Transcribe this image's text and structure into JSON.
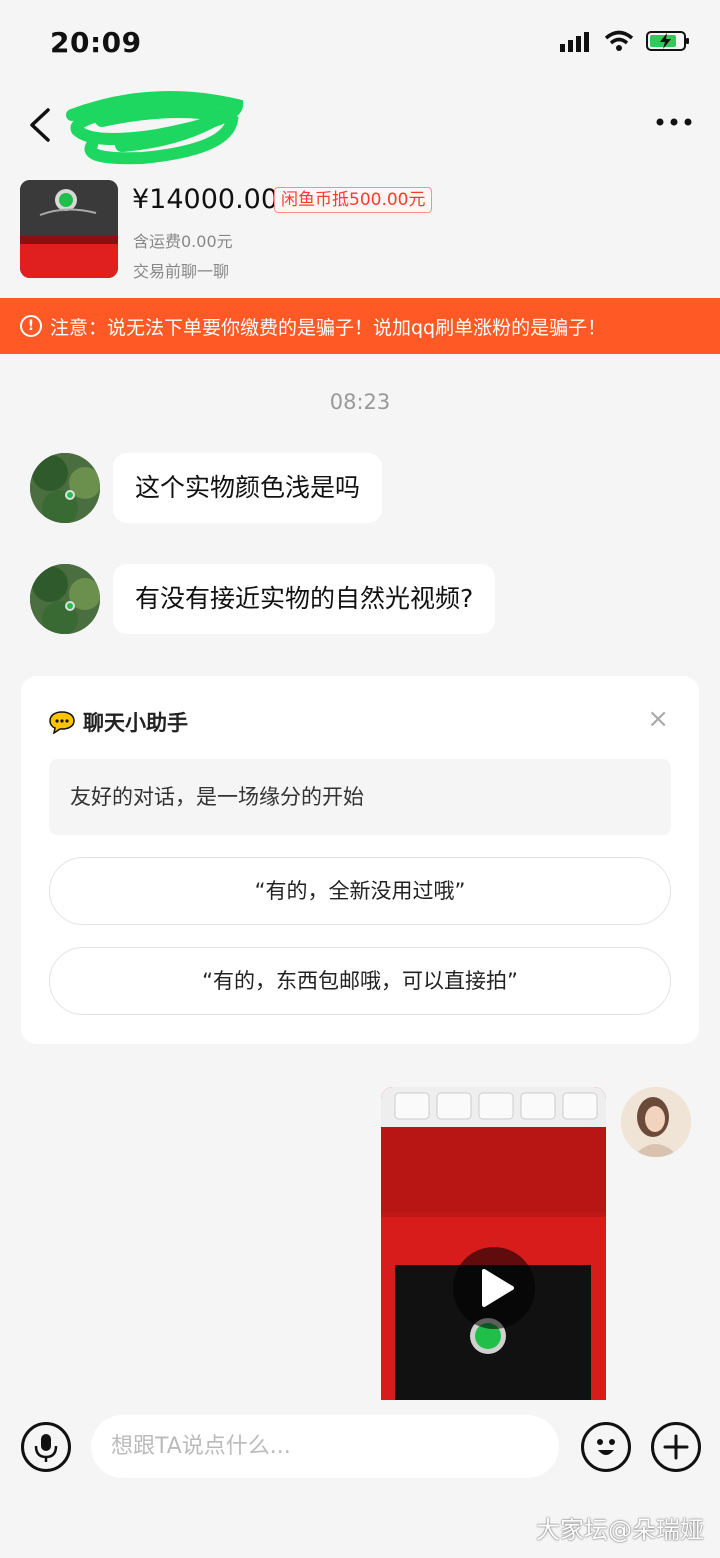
{
  "status_bar": {
    "time": "20:09"
  },
  "product": {
    "price": "¥14000.00",
    "coin_discount": "闲鱼币抵500.00元",
    "shipping": "含运费0.00元",
    "trade_tip": "交易前聊一聊"
  },
  "warning": {
    "icon": "!",
    "text": "注意：说无法下单要你缴费的是骗子！说加qq刷单涨粉的是骗子！"
  },
  "chat": {
    "timestamp": "08:23",
    "messages": [
      {
        "text": "这个实物颜色浅是吗"
      },
      {
        "text": "有没有接近实物的自然光视频?"
      }
    ]
  },
  "assistant": {
    "title": "聊天小助手",
    "close": "×",
    "hint": "友好的对话，是一场缘分的开始",
    "replies": [
      "“有的，全新没用过哦”",
      "“有的，东西包邮哦，可以直接拍”"
    ]
  },
  "input": {
    "placeholder": "想跟TA说点什么..."
  },
  "watermark": "大家坛@朵瑞娅",
  "colors": {
    "accent": "#ff5a26",
    "coin_red": "#ff3b30",
    "jade_green": "#1fbf4a",
    "redact_green": "#1ed760"
  },
  "icons": [
    "back-icon",
    "more-icon",
    "signal-icon",
    "wifi-icon",
    "battery-icon",
    "chat-bubble-icon",
    "play-icon",
    "mic-icon",
    "emoji-icon",
    "plus-icon"
  ]
}
